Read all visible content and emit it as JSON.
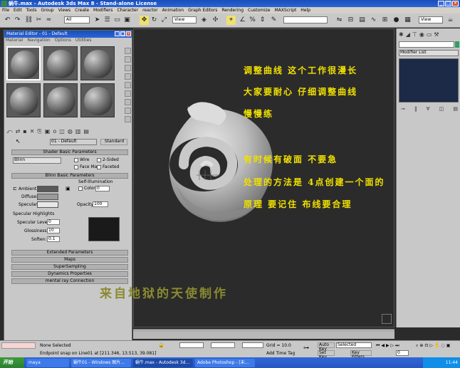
{
  "window": {
    "title": "蜗牛.max - Autodesk 3ds Max 8 - Stand-alone License"
  },
  "menubar": {
    "items": [
      "File",
      "Edit",
      "Tools",
      "Group",
      "Views",
      "Create",
      "Modifiers",
      "Character",
      "reactor",
      "Animation",
      "Graph Editors",
      "Rendering",
      "Customize",
      "MAXScript",
      "Help"
    ]
  },
  "toolbar": {
    "filter_select": "All",
    "view_select_1": "View",
    "view_select_2": "View"
  },
  "material_editor": {
    "title": "Material Editor - 01 - Default",
    "menu": [
      "Material",
      "Navigation",
      "Options",
      "Utilities"
    ],
    "material_name": "01 - Default",
    "material_type": "Standard",
    "rollouts": {
      "shader_basic": "Shader Basic Parameters",
      "shader_type": "Blinn",
      "wire": "Wire",
      "two_sided": "2-Sided",
      "face_map": "Face Map",
      "faceted": "Faceted",
      "blinn_basic": "Blinn Basic Parameters",
      "self_illum": "Self-Illumination",
      "color_label": "Color",
      "color_value": "0",
      "ambient": "Ambient:",
      "diffuse": "Diffuse:",
      "specular": "Specular:",
      "opacity_label": "Opacity:",
      "opacity_value": "100",
      "spec_highlights": "Specular Highlights",
      "spec_level": "Specular Level:",
      "spec_level_value": "0",
      "glossiness": "Glossiness:",
      "glossiness_value": "10",
      "soften": "Soften:",
      "soften_value": "0.1",
      "collapsed": [
        "Extended Parameters",
        "Maps",
        "SuperSampling",
        "Dynamics Properties",
        "mental ray Connection"
      ]
    }
  },
  "command_panel": {
    "modifier_list": "Modifier List"
  },
  "annotations": {
    "line1": "调整曲线 这个工作很漫长",
    "line2": "大家要耐心 仔细调整曲线",
    "line3": "慢慢练",
    "line4": "有时候有破面 不要急",
    "line5": "处理的方法是 4点创建一个面的",
    "line6": "原理  要记住  布线要合理",
    "signature": "来自地狱的天使制作"
  },
  "status": {
    "none_selected": "None Selected",
    "prompt": "Endpoint snap on Line01 at [211.346, 13.513, 39.081]",
    "grid": "Grid = 10.0",
    "add_time_tag": "Add Time Tag",
    "auto_key": "Auto Key",
    "set_key": "Set Key",
    "selected": "Selected",
    "key_filters": "Key Filters...",
    "frame": "0"
  },
  "taskbar": {
    "start": "开始",
    "tasks": [
      "maya",
      "蜗牛01 - Windows 图片...",
      "蜗牛.max - Autodesk 3d...",
      "Adobe Photoshop - [未..."
    ],
    "clock": "11:44"
  },
  "colors": {
    "annotation": "#f0e000",
    "signature": "#8a8a30",
    "titlebar": "#1a4fb8"
  }
}
